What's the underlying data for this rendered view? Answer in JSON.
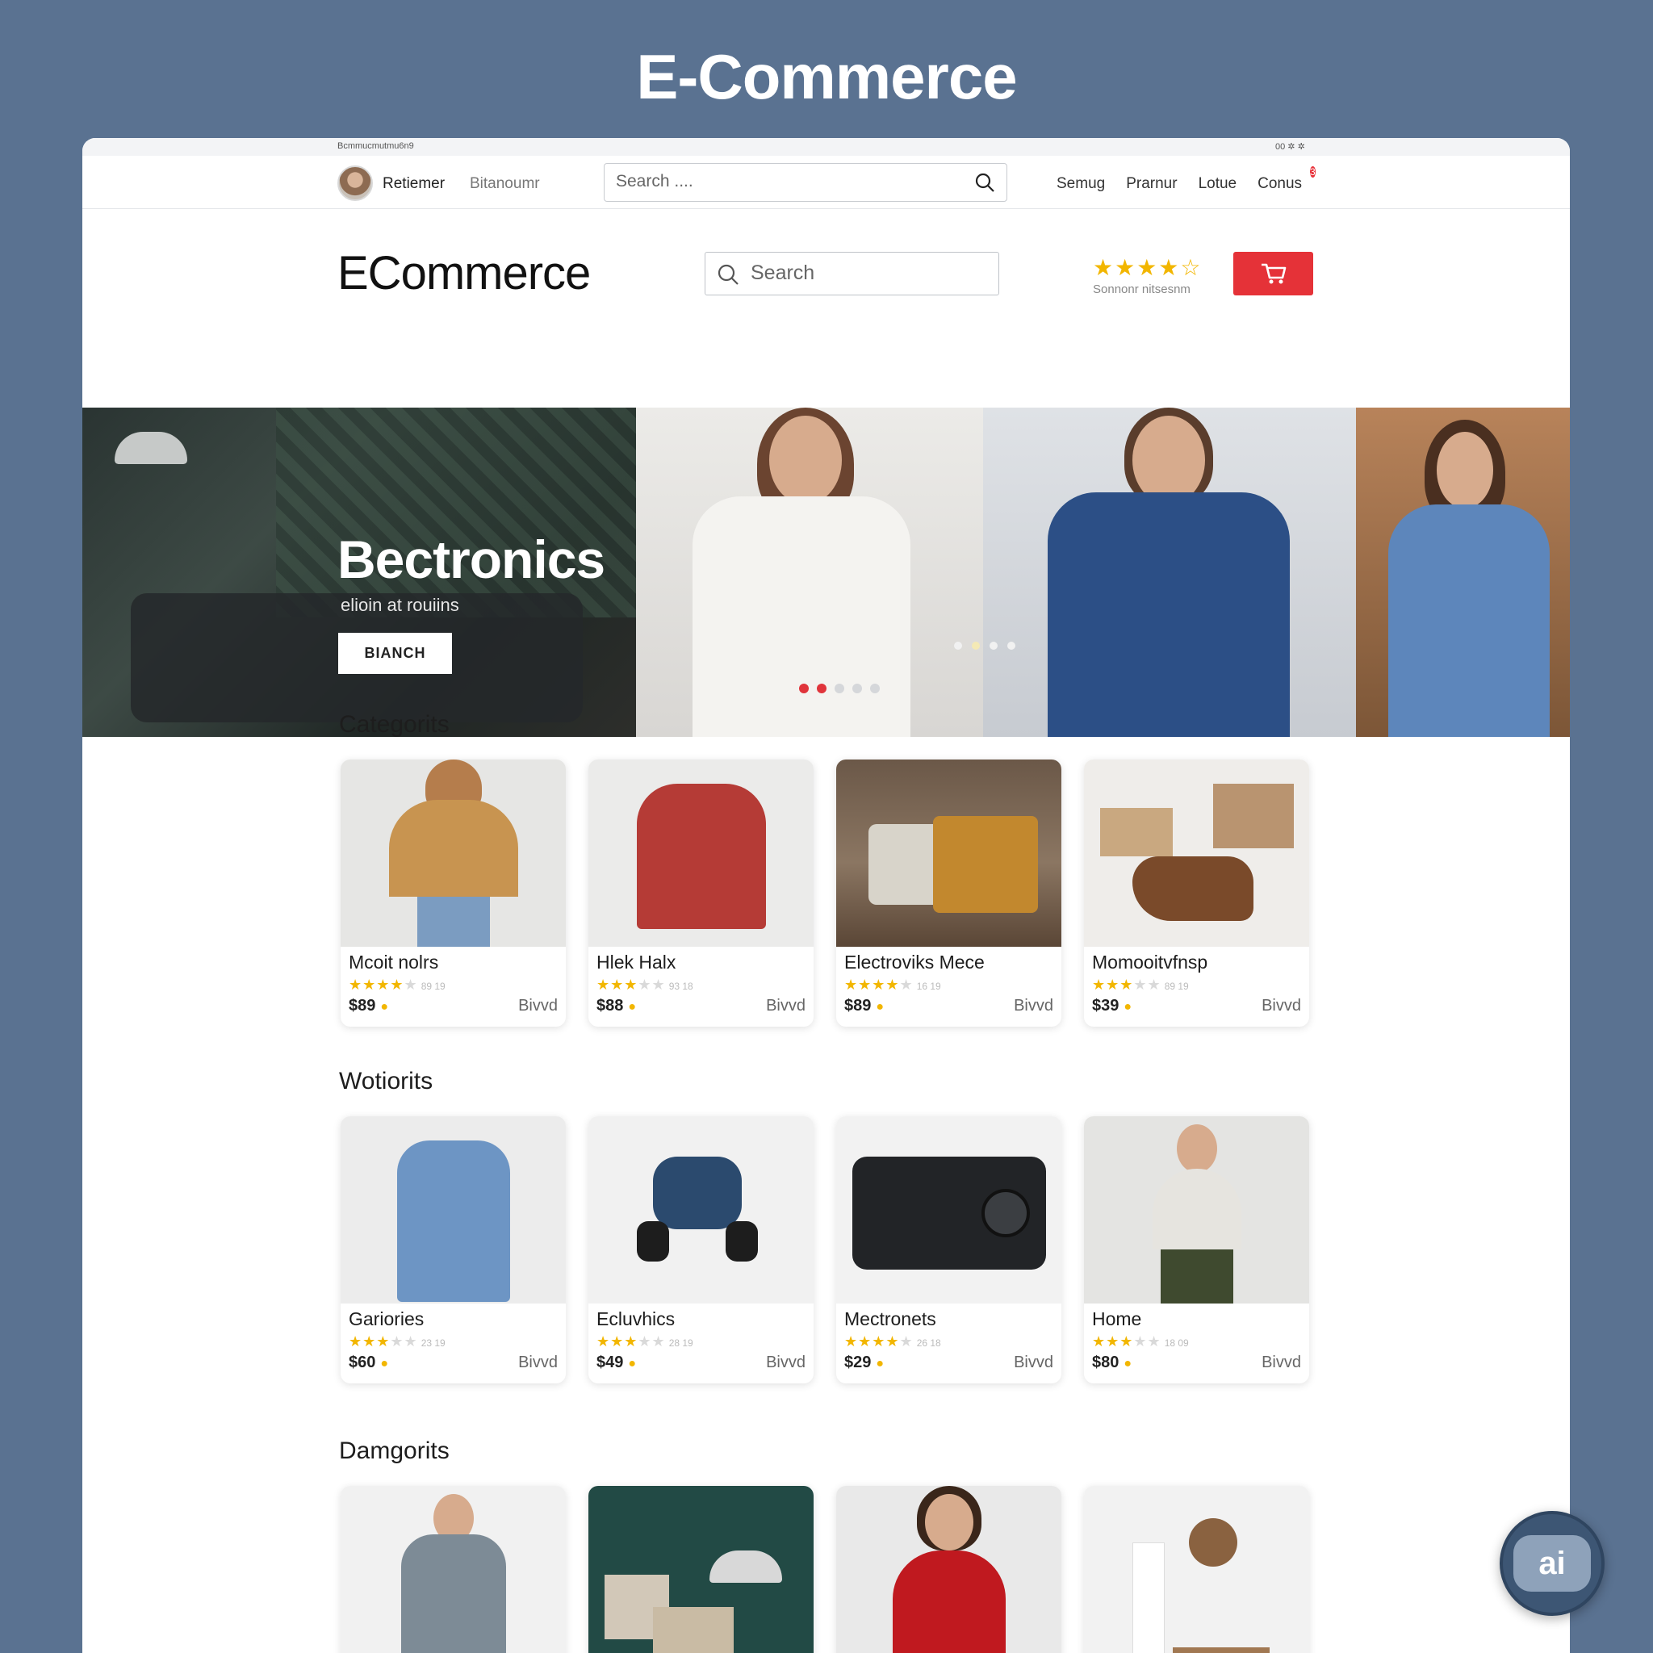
{
  "page": {
    "title": "E-Commerce"
  },
  "top_bar": {
    "status_left": "Bcmmucmutmu6n9",
    "status_right": "00 ✲ ✲",
    "brand": "Retiemer",
    "sub_brand": "Bitanoumr",
    "search_placeholder": "Search ....",
    "links": [
      {
        "label": "Semug"
      },
      {
        "label": "Prarnur"
      },
      {
        "label": "Lotue"
      },
      {
        "label": "Conus",
        "badge": "3"
      }
    ]
  },
  "header": {
    "logo": "ECommerce",
    "search_placeholder": "Search",
    "rating_stars": "★★★★☆",
    "rating_label": "Sonnonr nitsesnm"
  },
  "hero": {
    "title": "Bectronics",
    "subtitle": "elioin at rouiins",
    "button_label": "BIANCH"
  },
  "sections": [
    {
      "title": "Categorits",
      "products": [
        {
          "name": "Mcoit nolrs",
          "stars": "★★★★",
          "dim": "★",
          "count": "89 19",
          "price": "$89",
          "action": "Bivvd",
          "img": "sweater-woman"
        },
        {
          "name": "Hlek Halx",
          "stars": "★★★",
          "dim": "★★",
          "count": "93 18",
          "price": "$88",
          "action": "Bivvd",
          "img": "red-sweater"
        },
        {
          "name": "Electroviks Mece",
          "stars": "★★★★",
          "dim": "★",
          "count": "16 19",
          "price": "$89",
          "action": "Bivvd",
          "img": "sofa"
        },
        {
          "name": "Momooitvfnsp",
          "stars": "★★★",
          "dim": "★★",
          "count": "89 19",
          "price": "$39",
          "action": "Bivvd",
          "img": "boot"
        }
      ]
    },
    {
      "title": "Wotiorits",
      "products": [
        {
          "name": "Gariories",
          "stars": "★★★",
          "dim": "★★",
          "count": "23 19",
          "price": "$60",
          "action": "Bivvd",
          "img": "denim-shirt"
        },
        {
          "name": "Ecluvhics",
          "stars": "★★★",
          "dim": "★★",
          "count": "28 19",
          "price": "$49",
          "action": "Bivvd",
          "img": "gadget"
        },
        {
          "name": "Mectronets",
          "stars": "★★★★",
          "dim": "★",
          "count": "26 18",
          "price": "$29",
          "action": "Bivvd",
          "img": "camera"
        },
        {
          "name": "Home",
          "stars": "★★★",
          "dim": "★★",
          "count": "18 09",
          "price": "$80",
          "action": "Bivvd",
          "img": "man-jacket"
        }
      ]
    },
    {
      "title": "Damgorits",
      "products": [
        {
          "img": "patterned-jacket"
        },
        {
          "img": "boxes-lamp"
        },
        {
          "img": "red-top"
        },
        {
          "img": "shelf-decor"
        }
      ]
    }
  ],
  "float_button": {
    "label": "ai"
  },
  "colors": {
    "accent": "#e53238",
    "background": "#5a7291",
    "star": "#f2b600"
  }
}
